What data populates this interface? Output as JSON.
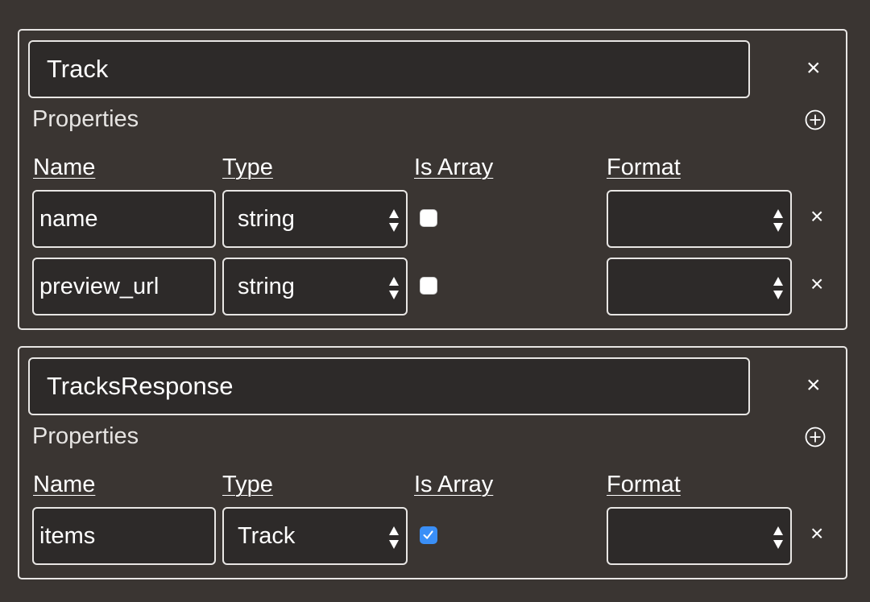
{
  "columns": {
    "name": "Name",
    "type": "Type",
    "is_array": "Is Array",
    "format": "Format"
  },
  "models": [
    {
      "name": "Track",
      "properties_label": "Properties",
      "close_glyph": "×",
      "properties": [
        {
          "name": "name",
          "type": "string",
          "is_array": false,
          "format": "",
          "remove_glyph": "×"
        },
        {
          "name": "preview_url",
          "type": "string",
          "is_array": false,
          "format": "",
          "remove_glyph": "×"
        }
      ]
    },
    {
      "name": "TracksResponse",
      "properties_label": "Properties",
      "close_glyph": "×",
      "properties": [
        {
          "name": "items",
          "type": "Track",
          "is_array": true,
          "format": "",
          "remove_glyph": "×"
        }
      ]
    }
  ],
  "colors": {
    "background": "#3a3532",
    "field": "#2d2a29",
    "border": "#e8e6e4",
    "checkbox_checked": "#3a8ff7"
  },
  "icons": {
    "add": "plus-circle-icon",
    "close": "close-icon",
    "select_arrows": "up-down-arrows-icon",
    "check": "checkmark-icon"
  }
}
